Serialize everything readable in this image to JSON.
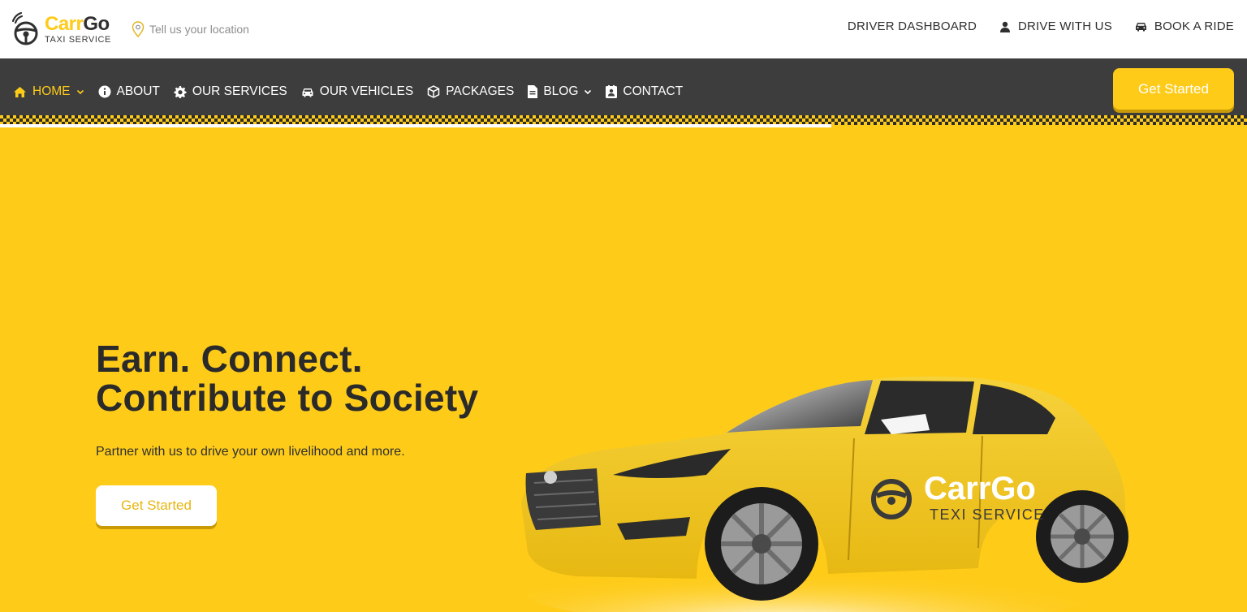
{
  "brand": {
    "name_part1": "Carr",
    "name_part2": "Go",
    "tagline": "TAXI SERVICE",
    "accent_color": "#fecb19",
    "dark_color": "#3d3d3d"
  },
  "location": {
    "icon": "map-pin-icon",
    "text": "Tell us your location"
  },
  "top_links": [
    {
      "label": "DRIVER DASHBOARD",
      "icon": ""
    },
    {
      "label": "DRIVE WITH US",
      "icon": "user-icon"
    },
    {
      "label": "BOOK A RIDE",
      "icon": "car-icon"
    }
  ],
  "nav": {
    "items": [
      {
        "label": "HOME",
        "icon": "home-icon",
        "dropdown": true,
        "active": true
      },
      {
        "label": "ABOUT",
        "icon": "info-icon"
      },
      {
        "label": "OUR SERVICES",
        "icon": "gear-icon"
      },
      {
        "label": "OUR VEHICLES",
        "icon": "car-icon"
      },
      {
        "label": "PACKAGES",
        "icon": "box-icon"
      },
      {
        "label": "BLOG",
        "icon": "document-icon",
        "dropdown": true
      },
      {
        "label": "CONTACT",
        "icon": "contact-card-icon"
      }
    ],
    "cta_label": "Get Started"
  },
  "hero": {
    "title_line1": "Earn. Connect.",
    "title_line2": "Contribute to Society",
    "subtitle": "Partner with us to drive your own livelihood and more.",
    "cta_label": "Get Started",
    "car_decal_name": "CarrGo",
    "car_decal_sub": "TEXI SERVICE"
  }
}
